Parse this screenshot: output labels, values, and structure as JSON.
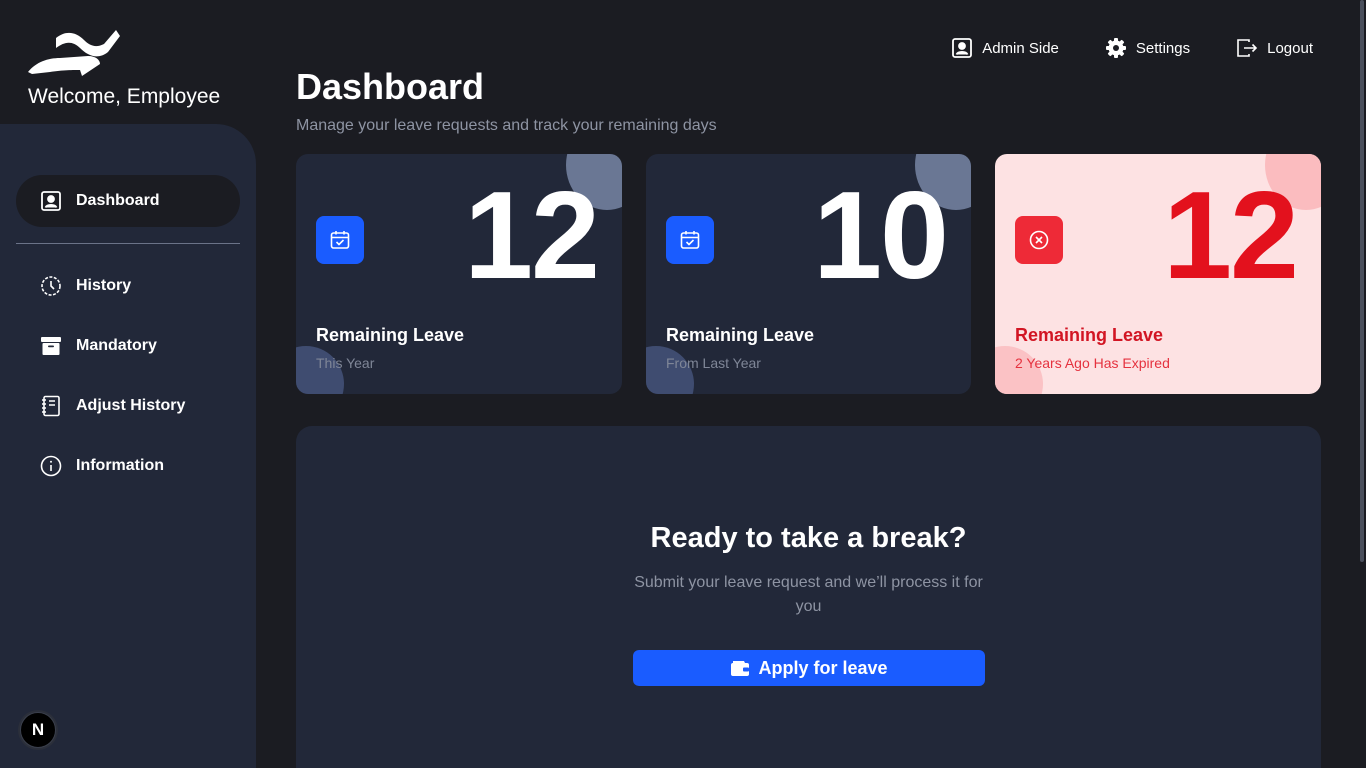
{
  "sidebar": {
    "welcome": "Welcome, Employee",
    "items": [
      {
        "label": "Dashboard",
        "icon": "user-square-icon",
        "active": true
      },
      {
        "label": "History",
        "icon": "clock-icon",
        "active": false
      },
      {
        "label": "Mandatory",
        "icon": "archive-icon",
        "active": false
      },
      {
        "label": "Adjust History",
        "icon": "notebook-icon",
        "active": false
      },
      {
        "label": "Information",
        "icon": "info-icon",
        "active": false
      }
    ],
    "badge": "N"
  },
  "topbar": {
    "admin_label": "Admin Side",
    "settings_label": "Settings",
    "logout_label": "Logout"
  },
  "header": {
    "title": "Dashboard",
    "subtitle": "Manage your leave requests and track your remaining days"
  },
  "cards": [
    {
      "value": "12",
      "title": "Remaining Leave",
      "subtitle": "This Year",
      "icon": "calendar-check-icon"
    },
    {
      "value": "10",
      "title": "Remaining Leave",
      "subtitle": "From Last Year",
      "icon": "calendar-check-icon"
    },
    {
      "value": "12",
      "title": "Remaining Leave",
      "subtitle": "2 Years Ago Has Expired",
      "icon": "x-circle-icon"
    }
  ],
  "panel": {
    "title": "Ready to take a break?",
    "text": "Submit your leave request and we’ll process it for you",
    "button_label": "Apply for leave"
  },
  "colors": {
    "background": "#1b1c22",
    "sidebar": "#222839",
    "accent": "#1a5cff",
    "danger": "#e3111d",
    "danger_bg": "#fde2e3"
  }
}
